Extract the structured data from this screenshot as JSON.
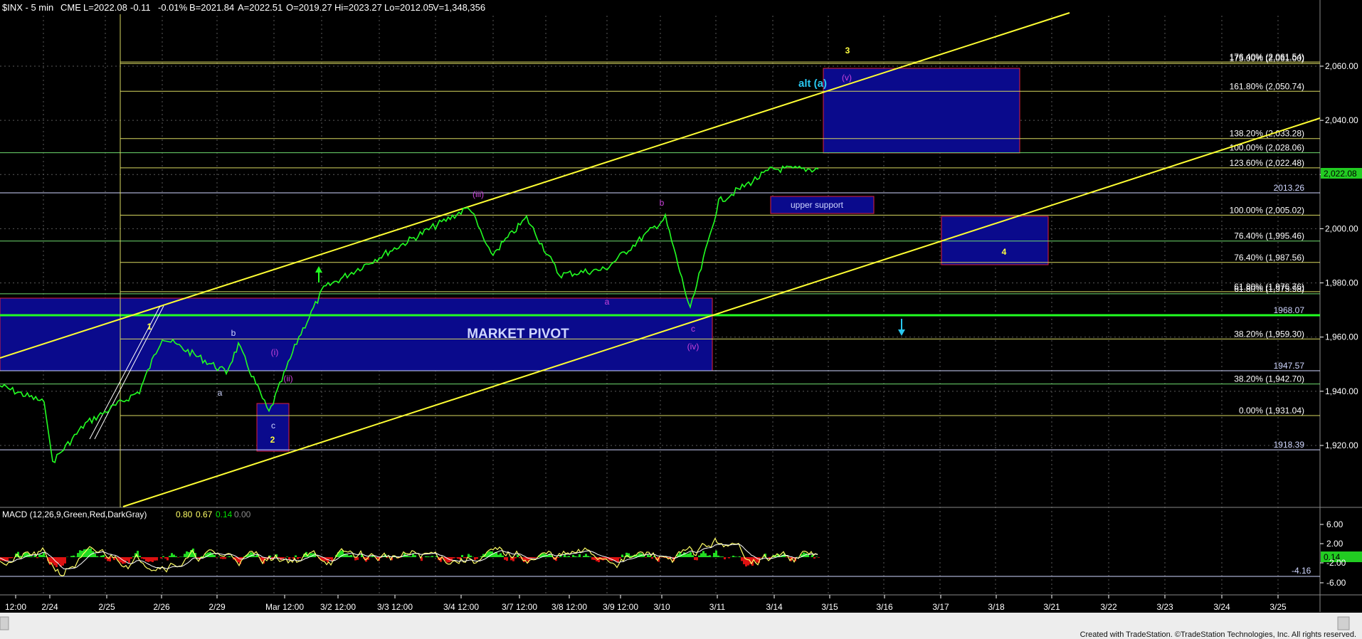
{
  "header": {
    "symbol": "$INX - 5 min",
    "exchange": "CME",
    "last": "L=2022.08",
    "change": "-0.11",
    "pct": "-0.01%",
    "bid": "B=2021.84",
    "ask": "A=2022.51",
    "open": "O=2019.27",
    "high": "Hi=2023.27",
    "low": "Lo=2012.05",
    "volume": "V=1,348,356"
  },
  "last_price_tag": "2,022.08",
  "macd": {
    "title": "MACD (12,26,9,Green,Red,DarkGray)",
    "values": [
      {
        "text": "0.80",
        "color": "#ffff66"
      },
      {
        "text": "0.67",
        "color": "#ffff66"
      },
      {
        "text": "0.14",
        "color": "#00e000"
      },
      {
        "text": "0.00",
        "color": "#8a8a8a"
      }
    ],
    "current_tag": "0.14",
    "level_label": "-4.16",
    "axis_ticks": [
      "6.00",
      "2.00",
      "-2.00",
      "-6.00"
    ]
  },
  "x_ticks": [
    "12:00",
    "2/24",
    "2/25",
    "2/26",
    "2/29",
    "Mar 12:00",
    "3/2 12:00",
    "3/3 12:00",
    "3/4 12:00",
    "3/7 12:00",
    "3/8 12:00",
    "3/9 12:00",
    "3/10",
    "3/11",
    "3/14",
    "3/15",
    "3/16",
    "3/17",
    "3/18",
    "3/21",
    "3/22",
    "3/23",
    "3/24",
    "3/25"
  ],
  "footer": "Created with TradeStation. ©TradeStation Technologies, Inc. All rights reserved.",
  "chart_data": {
    "type": "line",
    "title": "$INX - 5 min",
    "y_axis_ticks": [
      "2,060.00",
      "2,040.00",
      "2,020.00",
      "2,000.00",
      "1,980.00",
      "1,960.00",
      "1,940.00",
      "1,920.00"
    ],
    "ylim": [
      1912,
      2076
    ],
    "fib_levels": [
      {
        "label": "176.40% (2,061.54)",
        "value": 2061.54,
        "color": "#d8d860"
      },
      {
        "label": "175.00% (2,061.00)",
        "value": 2061.0,
        "color": "#d8d860"
      },
      {
        "label": "161.80% (2,050.74)",
        "value": 2050.74,
        "color": "#d8d860"
      },
      {
        "label": "138.20% (2,033.28)",
        "value": 2033.28,
        "color": "#d8d860"
      },
      {
        "label": "100.00% (2,028.06)",
        "value": 2028.06,
        "color": "#6fdc6f"
      },
      {
        "label": "123.60% (2,022.48)",
        "value": 2022.48,
        "color": "#d8d860"
      },
      {
        "label": "100.00% (2,005.02)",
        "value": 2005.02,
        "color": "#d8d860"
      },
      {
        "label": "76.40% (1,995.46)",
        "value": 1995.46,
        "color": "#6fdc6f"
      },
      {
        "label": "76.40% (1,987.56)",
        "value": 1987.56,
        "color": "#d8d860"
      },
      {
        "label": "61.80% (1,976.76)",
        "value": 1976.76,
        "color": "#d8d860"
      },
      {
        "label": "61.80% (1,975.98)",
        "value": 1975.98,
        "color": "#6fdc6f"
      },
      {
        "label": "38.20% (1,959.30)",
        "value": 1959.3,
        "color": "#d8d860"
      },
      {
        "label": "38.20% (1,942.70)",
        "value": 1942.7,
        "color": "#6fdc6f"
      },
      {
        "label": "0.00% (1,931.04)",
        "value": 1931.04,
        "color": "#d8d860"
      }
    ],
    "price_levels": [
      {
        "label": "2013.26",
        "value": 2013.26
      },
      {
        "label": "1968.07",
        "value": 1968.07
      },
      {
        "label": "1947.57",
        "value": 1947.57
      },
      {
        "label": "1918.39",
        "value": 1918.39
      }
    ],
    "annotations": {
      "market_pivot": "MARKET PIVOT",
      "upper_support": "upper support",
      "alt_a": "alt (a)",
      "wave_labels": [
        {
          "text": "1",
          "color": "#ffff40",
          "bold": true
        },
        {
          "text": "2",
          "color": "#ffff40",
          "bold": true
        },
        {
          "text": "3",
          "color": "#ffff40",
          "bold": true
        },
        {
          "text": "4",
          "color": "#ffff40",
          "bold": true
        },
        {
          "text": "a",
          "color": "#cfd6ff"
        },
        {
          "text": "b",
          "color": "#cfd6ff"
        },
        {
          "text": "c",
          "color": "#cfd6ff"
        },
        {
          "text": "(i)",
          "color": "#cc44dd"
        },
        {
          "text": "(ii)",
          "color": "#cc44dd"
        },
        {
          "text": "(iii)",
          "color": "#cc44dd"
        },
        {
          "text": "(iv)",
          "color": "#cc44dd"
        },
        {
          "text": "(v)",
          "color": "#cc44dd"
        },
        {
          "text": "a",
          "color": "#cc44dd"
        },
        {
          "text": "b",
          "color": "#cc44dd"
        },
        {
          "text": "c",
          "color": "#cc44dd"
        }
      ]
    },
    "price_path": [
      {
        "x": "2/23 late",
        "y": 1942
      },
      {
        "x": "2/24",
        "y": 1936
      },
      {
        "x": "2/24 low",
        "y": 1914
      },
      {
        "x": "2/25",
        "y": 1928
      },
      {
        "x": "2/25 late",
        "y": 1940
      },
      {
        "x": "2/26 high",
        "y": 1960
      },
      {
        "x": "2/26",
        "y": 1947
      },
      {
        "x": "2/29",
        "y": 1957
      },
      {
        "x": "2/29 low",
        "y": 1932
      },
      {
        "x": "Mar 12:00",
        "y": 1960
      },
      {
        "x": "3/2",
        "y": 1978
      },
      {
        "x": "3/3",
        "y": 1987
      },
      {
        "x": "3/4 12:00",
        "y": 2008
      },
      {
        "x": "3/7",
        "y": 1990
      },
      {
        "x": "3/7 12:00",
        "y": 2004
      },
      {
        "x": "3/8",
        "y": 1983
      },
      {
        "x": "3/9",
        "y": 1985
      },
      {
        "x": "3/10 high",
        "y": 2004
      },
      {
        "x": "3/10 low",
        "y": 1970
      },
      {
        "x": "3/11",
        "y": 2010
      },
      {
        "x": "3/14",
        "y": 2022
      },
      {
        "x": "3/14 late",
        "y": 2022
      }
    ],
    "series": [
      {
        "name": "MACD",
        "color": "#ffff66"
      },
      {
        "name": "Signal",
        "color": "#ffffff"
      }
    ],
    "grid": true
  }
}
